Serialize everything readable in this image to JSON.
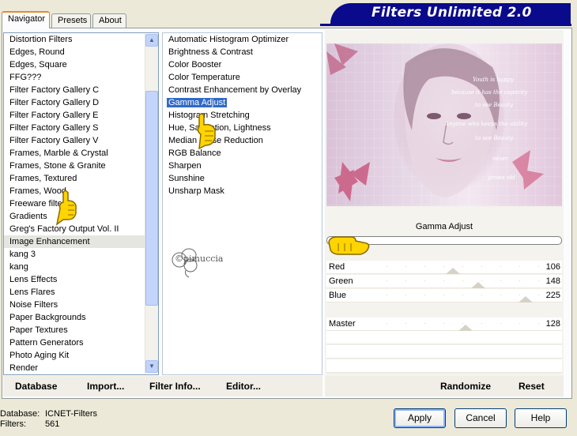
{
  "tabs": [
    {
      "label": "Navigator"
    },
    {
      "label": "Presets"
    },
    {
      "label": "About"
    }
  ],
  "banner": {
    "title": "Filters Unlimited 2.0"
  },
  "categories": [
    "Distortion Filters",
    "Edges, Round",
    "Edges, Square",
    "FFG???",
    "Filter Factory Gallery C",
    "Filter Factory Gallery D",
    "Filter Factory Gallery E",
    "Filter Factory Gallery S",
    "Filter Factory Gallery V",
    "Frames, Marble & Crystal",
    "Frames, Stone & Granite",
    "Frames, Textured",
    "Frames, Wood",
    "Freeware filte",
    "Gradients",
    "Greg's Factory Output Vol. II",
    "Image Enhancement",
    "kang 3",
    "kang",
    "Lens Effects",
    "Lens Flares",
    "Noise Filters",
    "Paper Backgrounds",
    "Paper Textures",
    "Pattern Generators",
    "Photo Aging Kit",
    "Render"
  ],
  "selected_category_index": 16,
  "filters": [
    "Automatic Histogram Optimizer",
    "Brightness & Contrast",
    "Color Booster",
    "Color Temperature",
    "Contrast Enhancement by Overlay",
    "Gamma Adjust",
    "Histogram Stretching",
    "Hue, Saturation, Lightness",
    "Median Noise Reduction",
    "RGB Balance",
    "Sharpen",
    "Sunshine",
    "Unsharp Mask"
  ],
  "selected_filter_index": 5,
  "watermark": "©pimuccia",
  "preview": {
    "poem": [
      "Youth is happy",
      "because it has the capacity",
      "to see Beauty",
      "Anyone who keeps the ability",
      "to see Beauty",
      "never",
      "grows old"
    ]
  },
  "filter_name": "Gamma Adjust",
  "params": [
    {
      "label": "Red",
      "value": "106",
      "level": 0.42
    },
    {
      "label": "Green",
      "value": "148",
      "level": 0.58
    },
    {
      "label": "Blue",
      "value": "225",
      "level": 0.88
    },
    {
      "label": "Master",
      "value": "128",
      "level": 0.5
    }
  ],
  "actions": {
    "database": "Database",
    "import": "Import...",
    "filter_info": "Filter Info...",
    "editor": "Editor...",
    "randomize": "Randomize",
    "reset": "Reset"
  },
  "status": {
    "database_label": "Database:",
    "database_value": "ICNET-Filters",
    "filters_label": "Filters:",
    "filters_value": "561"
  },
  "buttons": {
    "apply": "Apply",
    "cancel": "Cancel",
    "help": "Help"
  },
  "colors": {
    "selection": "#316ac5",
    "banner": "#0a0a8c"
  }
}
